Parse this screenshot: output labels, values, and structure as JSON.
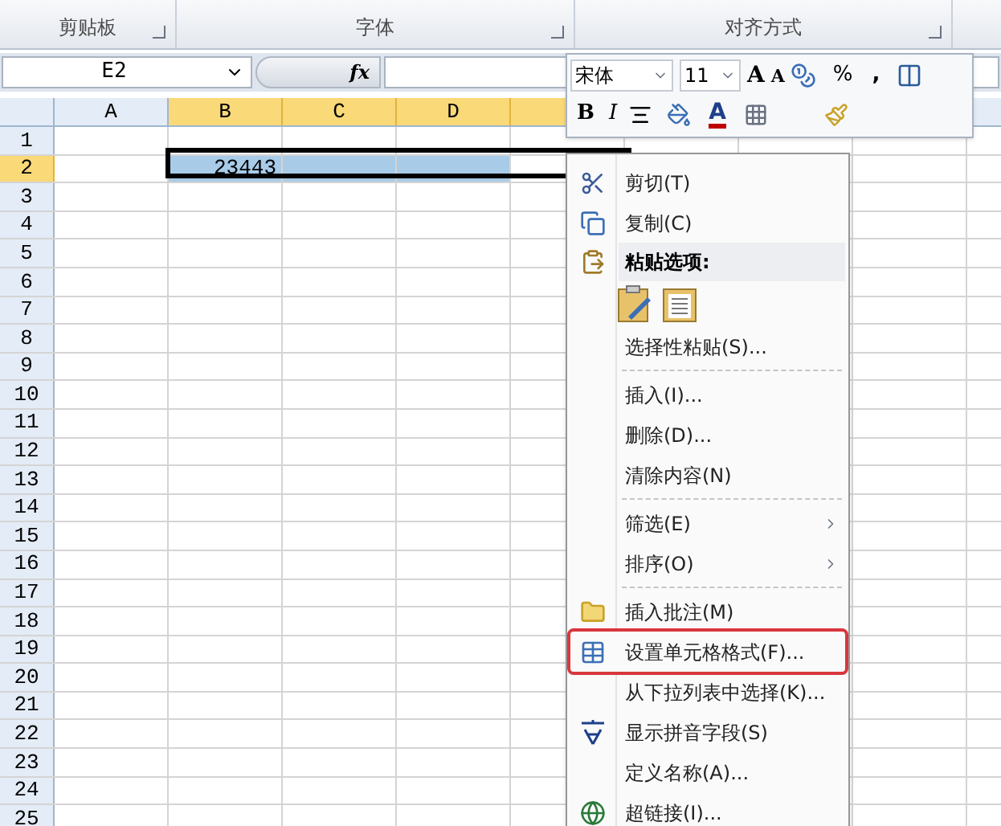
{
  "ribbon": {
    "groups": [
      {
        "label": "剪贴板"
      },
      {
        "label": "字体"
      },
      {
        "label": "对齐方式"
      }
    ]
  },
  "formula_bar": {
    "name_box": "E2",
    "fx_label": "fx"
  },
  "sheet": {
    "columns": [
      {
        "label": "A",
        "selected": false
      },
      {
        "label": "B",
        "selected": true
      },
      {
        "label": "C",
        "selected": true
      },
      {
        "label": "D",
        "selected": true
      },
      {
        "selected": true
      }
    ],
    "rows": [
      {
        "label": "1",
        "selected": false
      },
      {
        "label": "2",
        "selected": true
      },
      {
        "label": "3",
        "selected": false
      },
      {
        "label": "4",
        "selected": false
      },
      {
        "label": "5",
        "selected": false
      },
      {
        "label": "6",
        "selected": false
      },
      {
        "label": "7",
        "selected": false
      },
      {
        "label": "8",
        "selected": false
      },
      {
        "label": "9",
        "selected": false
      },
      {
        "label": "10",
        "selected": false
      },
      {
        "label": "11",
        "selected": false
      },
      {
        "label": "12",
        "selected": false
      },
      {
        "label": "13",
        "selected": false
      },
      {
        "label": "14",
        "selected": false
      },
      {
        "label": "15",
        "selected": false
      },
      {
        "label": "16",
        "selected": false
      },
      {
        "label": "17",
        "selected": false
      },
      {
        "label": "18",
        "selected": false
      },
      {
        "label": "19",
        "selected": false
      },
      {
        "label": "20",
        "selected": false
      },
      {
        "label": "21",
        "selected": false
      },
      {
        "label": "22",
        "selected": false
      },
      {
        "label": "23",
        "selected": false
      },
      {
        "label": "24",
        "selected": false
      },
      {
        "label": "25",
        "selected": false
      }
    ],
    "cell_b2": "23443"
  },
  "mini_toolbar": {
    "font": "宋体",
    "size": "11",
    "grow_font": "A",
    "shrink_font": "A",
    "percent": "%",
    "comma": ",",
    "bold": "B",
    "italic": "I",
    "font_color": "A"
  },
  "context_menu": [
    {
      "kind": "item",
      "label": "剪切(T)",
      "submenu": false,
      "highlighted": false
    },
    {
      "kind": "item",
      "label": "复制(C)",
      "submenu": false,
      "highlighted": false
    },
    {
      "kind": "header",
      "label": "粘贴选项:"
    },
    {
      "kind": "paste_icons"
    },
    {
      "kind": "item",
      "label": "选择性粘贴(S)...",
      "submenu": false,
      "highlighted": false
    },
    {
      "kind": "separator"
    },
    {
      "kind": "item",
      "label": "插入(I)...",
      "submenu": false,
      "highlighted": false
    },
    {
      "kind": "item",
      "label": "删除(D)...",
      "submenu": false,
      "highlighted": false
    },
    {
      "kind": "item",
      "label": "清除内容(N)",
      "submenu": false,
      "highlighted": false
    },
    {
      "kind": "separator"
    },
    {
      "kind": "item",
      "label": "筛选(E)",
      "submenu": true,
      "highlighted": false
    },
    {
      "kind": "item",
      "label": "排序(O)",
      "submenu": true,
      "highlighted": false
    },
    {
      "kind": "separator"
    },
    {
      "kind": "item",
      "label": "插入批注(M)",
      "submenu": false,
      "highlighted": false
    },
    {
      "kind": "item",
      "label": "设置单元格格式(F)...",
      "submenu": false,
      "highlighted": true
    },
    {
      "kind": "item",
      "label": "从下拉列表中选择(K)...",
      "submenu": false,
      "highlighted": false
    },
    {
      "kind": "item",
      "label": "显示拼音字段(S)",
      "submenu": false,
      "highlighted": false
    },
    {
      "kind": "item",
      "label": "定义名称(A)...",
      "submenu": false,
      "highlighted": false
    },
    {
      "kind": "item",
      "label": "超链接(I)...",
      "submenu": false,
      "highlighted": false
    }
  ]
}
